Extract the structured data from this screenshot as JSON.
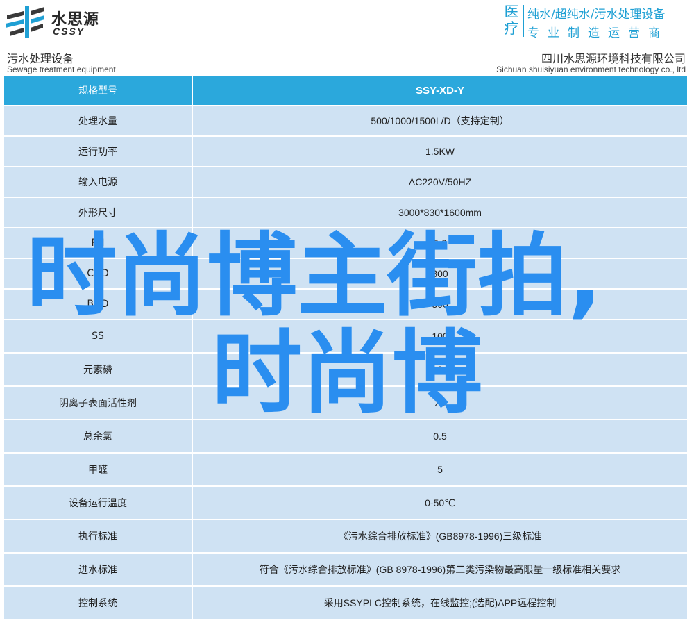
{
  "header": {
    "logo_cn": "水思源",
    "logo_en": "CSSY",
    "slogan_left_1": "医",
    "slogan_left_2": "疗",
    "slogan_top": "纯水/超纯水/污水处理设备",
    "slogan_bottom": "专业制造运营商",
    "brand_color": "#1fa0d4"
  },
  "title": {
    "left_cn": "污水处理设备",
    "left_en": "Sewage treatment equipment",
    "right_cn": "四川水思源环境科技有限公司",
    "right_en": "Sichuan shuisiyuan environment technology co., ltd"
  },
  "table": {
    "header": {
      "label": "规格型号",
      "value": "SSY-XD-Y"
    },
    "rows": [
      {
        "label": "处理水量",
        "value": "500/1000/1500L/D（支持定制）"
      },
      {
        "label": "运行功率",
        "value": "1.5KW"
      },
      {
        "label": "输入电源",
        "value": "AC220V/50HZ"
      },
      {
        "label": "外形尺寸",
        "value": "3000*830*1600mm"
      },
      {
        "label": "PH",
        "value": "6-9"
      },
      {
        "label": "COD",
        "value": "300"
      },
      {
        "label": "BOD",
        "value": "300"
      },
      {
        "label": "SS",
        "value": "100"
      },
      {
        "label": "元素磷",
        "value": "8"
      },
      {
        "label": "阴离子表面活性剂",
        "value": "20"
      },
      {
        "label": "总余氯",
        "value": "0.5"
      },
      {
        "label": "甲醛",
        "value": "5"
      },
      {
        "label": "设备运行温度",
        "value": "0-50℃"
      },
      {
        "label": "执行标准",
        "value": "《污水综合排放标准》(GB8978-1996)三级标准"
      },
      {
        "label": "进水标准",
        "value": "符合《污水综合排放标准》(GB 8978-1996)第二类污染物最高限量一级标准相关要求"
      },
      {
        "label": "控制系统",
        "value": "采用SSYPLC控制系统，在线监控;(选配)APP远程控制"
      }
    ],
    "header_color": "#2ba8dc",
    "row_color": "#cfe2f3"
  },
  "overlay": {
    "line1": "时尚博主街拍,",
    "line2": "时尚博",
    "color": "#2a8ef0"
  }
}
